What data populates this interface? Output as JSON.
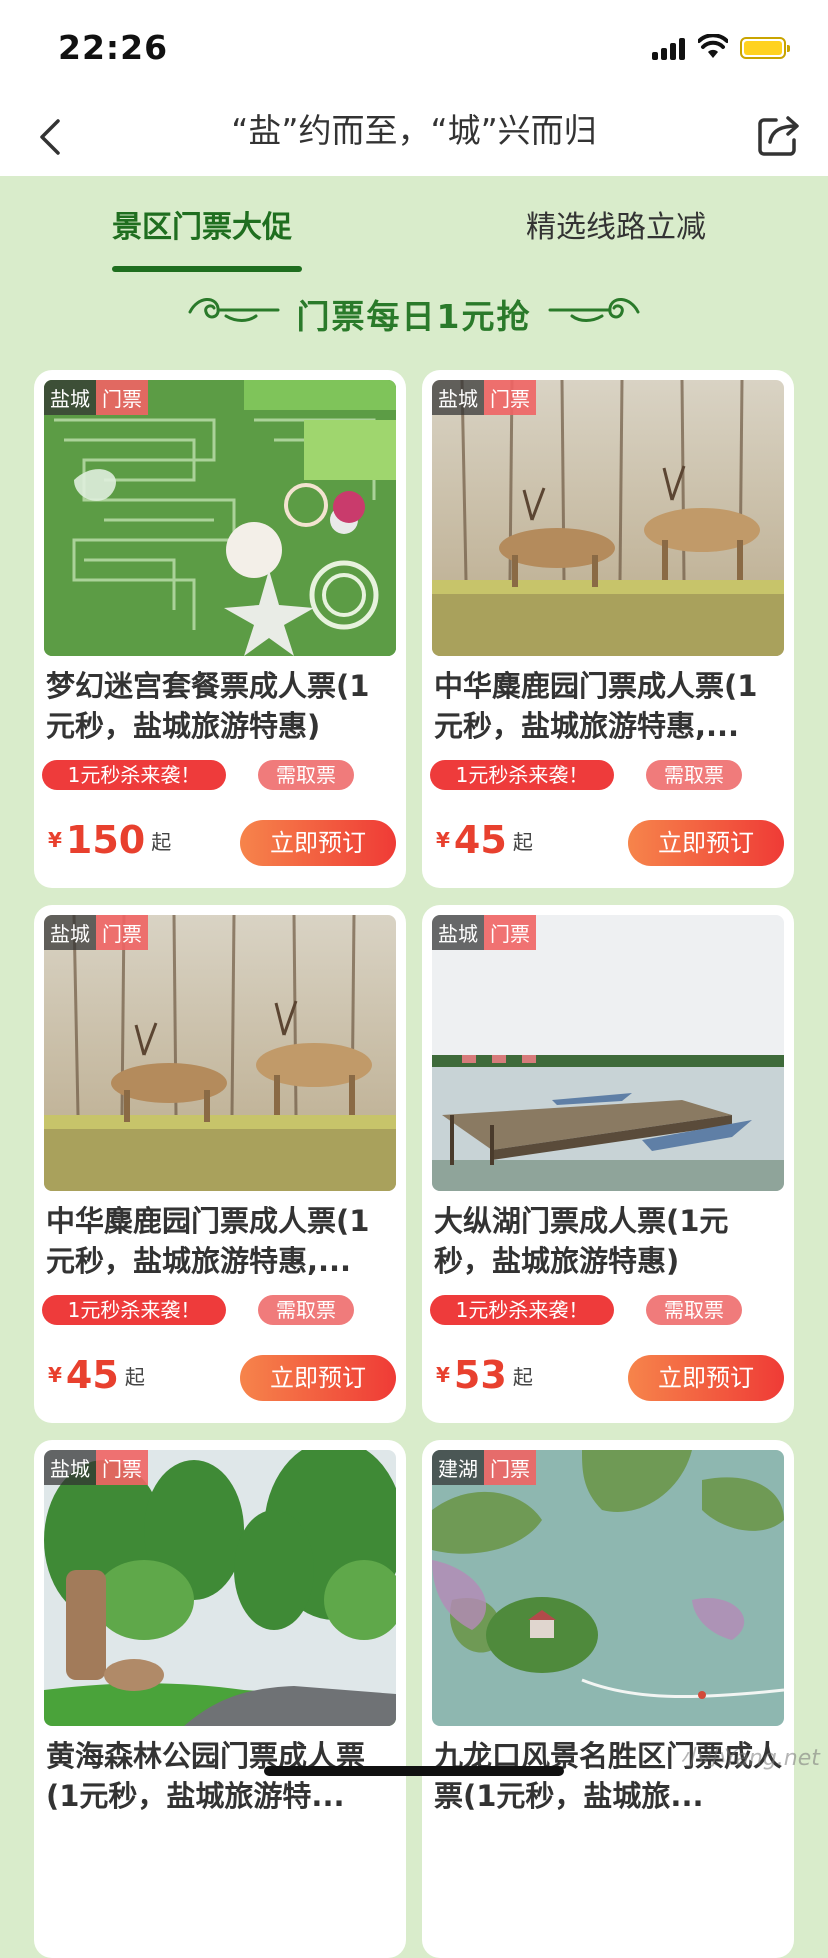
{
  "status_bar": {
    "time": "22:26"
  },
  "nav": {
    "title": "“盐”约而至，“城”兴而归"
  },
  "tabs": [
    {
      "label": "景区门票大促"
    },
    {
      "label": "精选线路立减"
    }
  ],
  "banner": {
    "text": "门票每日1元抢"
  },
  "cards": [
    {
      "city": "盐城",
      "type": "门票",
      "title": "梦幻迷宫套餐票成人票(1元秒，盐城旅游特惠)",
      "sale_badge": "1元秒杀来袭！",
      "pickup_badge": "需取票",
      "currency": "¥",
      "price": "150",
      "price_suffix": "起",
      "book_label": "立即预订"
    },
    {
      "city": "盐城",
      "type": "门票",
      "title": "中华麋鹿园门票成人票(1元秒，盐城旅游特惠,...",
      "sale_badge": "1元秒杀来袭！",
      "pickup_badge": "需取票",
      "currency": "¥",
      "price": "45",
      "price_suffix": "起",
      "book_label": "立即预订"
    },
    {
      "city": "盐城",
      "type": "门票",
      "title": "中华麋鹿园门票成人票(1元秒，盐城旅游特惠,...",
      "sale_badge": "1元秒杀来袭！",
      "pickup_badge": "需取票",
      "currency": "¥",
      "price": "45",
      "price_suffix": "起",
      "book_label": "立即预订"
    },
    {
      "city": "盐城",
      "type": "门票",
      "title": "大纵湖门票成人票(1元秒，盐城旅游特惠)",
      "sale_badge": "1元秒杀来袭！",
      "pickup_badge": "需取票",
      "currency": "¥",
      "price": "53",
      "price_suffix": "起",
      "book_label": "立即预订"
    },
    {
      "city": "盐城",
      "type": "门票",
      "title": "黄海森林公园门票成人票(1元秒，盐城旅游特..."
    },
    {
      "city": "建湖",
      "type": "门票",
      "title": "九龙口风景名胜区门票成人票(1元秒，盐城旅..."
    }
  ],
  "watermark": "小小Yang.net"
}
